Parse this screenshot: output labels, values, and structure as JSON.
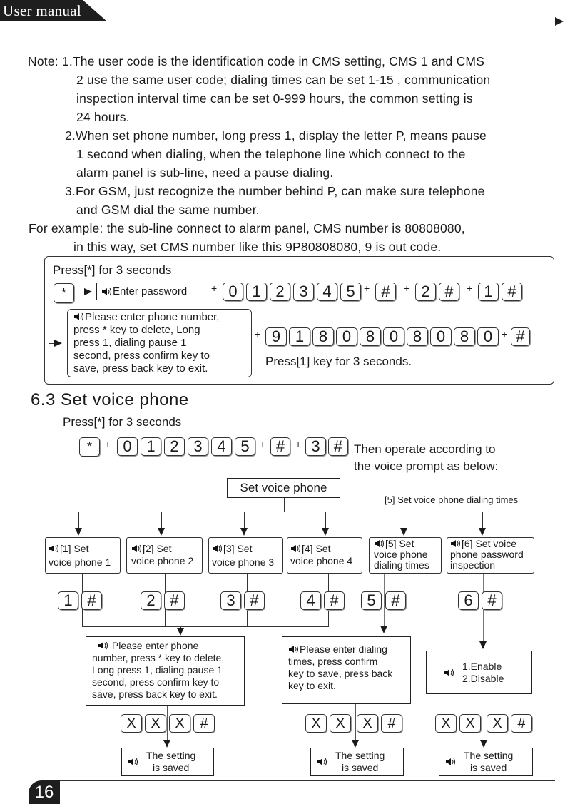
{
  "header": {
    "title": "User manual"
  },
  "notes": {
    "lines": [
      "Note: 1.The user code is the identification code in CMS setting, CMS 1 and CMS",
      "2 use the same user code; dialing times can be set 1-15 , communication",
      "inspection interval time can be set  0-999 hours, the common setting is",
      "24 hours.",
      "2.When set phone number, long press 1, display the letter P, means pause",
      "1 second when dialing, when the telephone line which connect to the",
      "alarm panel is sub-line, need a pause dialing.",
      "3.For GSM, just recognize the number behind P, can make sure telephone",
      "and GSM dial the same number.",
      "For example: the sub-line connect to alarm panel, CMS number is 80808080,",
      "in this way, set CMS number like this 9P80808080, 9 is out code."
    ]
  },
  "example_box": {
    "press_label": "Press[*] for 3 seconds",
    "star_key": "*",
    "enter_password": "Enter password",
    "password_keys": [
      "0",
      "1",
      "2",
      "3",
      "4",
      "5"
    ],
    "hash": "#",
    "menu_key": "2",
    "sub_key": "1",
    "prompt": [
      "Please enter phone number,",
      "press * key to delete, Long",
      "press 1, dialing pause 1",
      "second, press confirm key to",
      "save, press back key to exit."
    ],
    "number_keys": [
      "9",
      "1",
      "8",
      "0",
      "8",
      "0",
      "8",
      "0",
      "8",
      "0"
    ],
    "press1_label": "Press[1] key for 3 seconds.",
    "plus": "+"
  },
  "section": {
    "title": "6.3 Set voice phone",
    "press_label": "Press[*] for 3 seconds",
    "star_key": "*",
    "password_keys": [
      "0",
      "1",
      "2",
      "3",
      "4",
      "5"
    ],
    "hash": "#",
    "menu_key": "3",
    "then_text": [
      "Then operate according to",
      "the voice prompt as below:"
    ]
  },
  "flow": {
    "root": "Set voice phone",
    "side_label": "[5] Set voice phone dialing times",
    "options": [
      {
        "lines": [
          "[1] Set",
          "voice phone 1"
        ],
        "key": "1"
      },
      {
        "lines": [
          "[2] Set",
          "voice phone 2"
        ],
        "key": "2"
      },
      {
        "lines": [
          "[3] Set",
          "voice phone 3"
        ],
        "key": "3"
      },
      {
        "lines": [
          "[4] Set",
          "voice phone 4"
        ],
        "key": "4"
      },
      {
        "lines": [
          "[5] Set",
          "voice phone",
          "dialing times"
        ],
        "key": "5"
      },
      {
        "lines": [
          "[6] Set voice",
          "phone password",
          "inspection"
        ],
        "key": "6"
      }
    ],
    "prompt_phone": [
      "Please enter phone",
      "number, press * key to delete,",
      "Long press 1, dialing pause 1",
      "second, press confirm key to",
      "save, press back key to exit."
    ],
    "prompt_dialing": [
      "Please enter dialing",
      "times, press confirm",
      "key to save, press back",
      "key to exit."
    ],
    "prompt_enable": [
      "1.Enable",
      "2.Disable"
    ],
    "xxx_keys": [
      "X",
      "X",
      "X",
      "#"
    ],
    "saved": [
      "The setting",
      "is saved"
    ]
  },
  "footer": {
    "page_number": "16"
  }
}
